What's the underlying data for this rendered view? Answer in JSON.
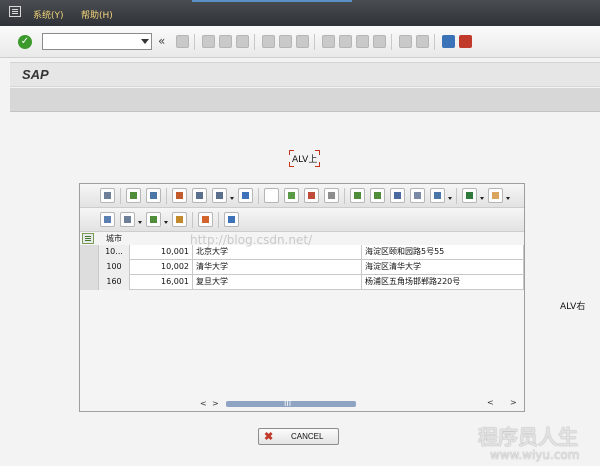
{
  "menubar": {
    "items": [
      {
        "label": "系统(Y)"
      },
      {
        "label": "帮助(H)"
      }
    ]
  },
  "toolbar": {
    "command_field": "",
    "expand_glyph": "«"
  },
  "title": "SAP",
  "containers": {
    "top_label": "ALV上",
    "right_label": "ALV右"
  },
  "grid": {
    "columns": [
      "城市",
      "",
      "",
      ""
    ],
    "rows": [
      [
        "10...",
        "10,001",
        "北京大学",
        "海淀区颐和园路5号55"
      ],
      [
        "100",
        "10,002",
        "清华大学",
        "海淀区清华大学"
      ],
      [
        "160",
        "16,001",
        "复旦大学",
        "杨浦区五角场邯郸路220号"
      ]
    ],
    "scroll": {
      "left": "<",
      "right": ">",
      "grip": "III"
    }
  },
  "cancel_button": {
    "label": "CANCEL",
    "icon": "cancel-x-icon",
    "icon_color": "#c0392b"
  },
  "watermarks": {
    "url": "http://blog.csdn.net/",
    "site_name": "程序员人生",
    "site_url": "www.wiyu.com"
  },
  "colors": {
    "menubar": "#2f3236",
    "menu_text": "#f3d37a",
    "ok": "#3c9a2c"
  }
}
